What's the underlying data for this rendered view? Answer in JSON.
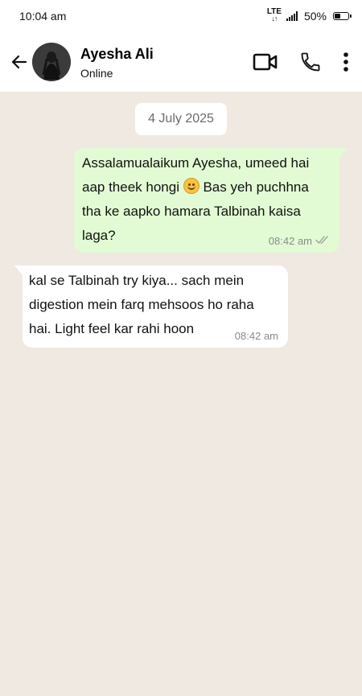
{
  "status_bar": {
    "time": "10:04 am",
    "network": "LTE",
    "battery_percent": "50%",
    "battery_level": 0.5
  },
  "header": {
    "contact_name": "Ayesha Ali",
    "contact_status": "Online",
    "icons": {
      "back": "back-arrow-icon",
      "video": "video-call-icon",
      "call": "phone-icon",
      "menu": "more-vertical-icon"
    }
  },
  "chat": {
    "date_label": "4 July 2025",
    "messages": [
      {
        "direction": "outgoing",
        "text_part1": " Assalamualaikum Ayesha, umeed hai aap theek hongi ",
        "emoji": "smiling-face-emoji",
        "text_part2": " Bas yeh puchhna tha ke aapko hamara Talbinah kaisa laga?",
        "time": "08:42 am",
        "status": "read"
      },
      {
        "direction": "incoming",
        "text": " kal se Talbinah try kiya... sach mein digestion mein farq mehsoos ho raha hai. Light feel kar rahi hoon",
        "time": "08:42 am"
      }
    ]
  },
  "colors": {
    "chat_background": "#efe9e2",
    "outgoing_bubble": "#e2fbd4",
    "incoming_bubble": "#ffffff",
    "meta_text": "#8a8a8a"
  }
}
